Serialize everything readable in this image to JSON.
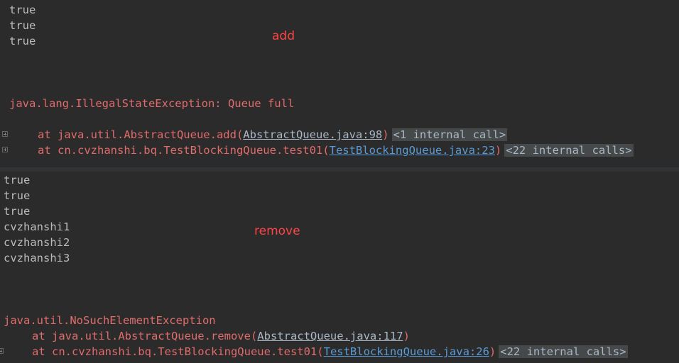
{
  "top": {
    "outputs": [
      "true",
      "true",
      "true"
    ],
    "annotation": "add",
    "exception": "java.lang.IllegalStateException: Queue full",
    "trace": [
      {
        "at": "at java.util.AbstractQueue.add(",
        "src": "AbstractQueue.java:98",
        "close": ")",
        "hint": "<1 internal call>"
      },
      {
        "at": "at cn.cvzhanshi.bq.TestBlockingQueue.test01(",
        "src": "TestBlockingQueue.java:23",
        "close": ")",
        "hint": "<22 internal calls>"
      }
    ]
  },
  "bottom": {
    "outputs": [
      "true",
      "true",
      "true",
      "cvzhanshi1",
      "cvzhanshi2",
      "cvzhanshi3"
    ],
    "annotation": "remove",
    "exception": "java.util.NoSuchElementException",
    "trace": [
      {
        "at": "at java.util.AbstractQueue.remove(",
        "src": "AbstractQueue.java:117",
        "close": ")",
        "hint": ""
      },
      {
        "at": "at cn.cvzhanshi.bq.TestBlockingQueue.test01(",
        "src": "TestBlockingQueue.java:26",
        "close": ")",
        "hint": "<22 internal calls>"
      }
    ]
  }
}
